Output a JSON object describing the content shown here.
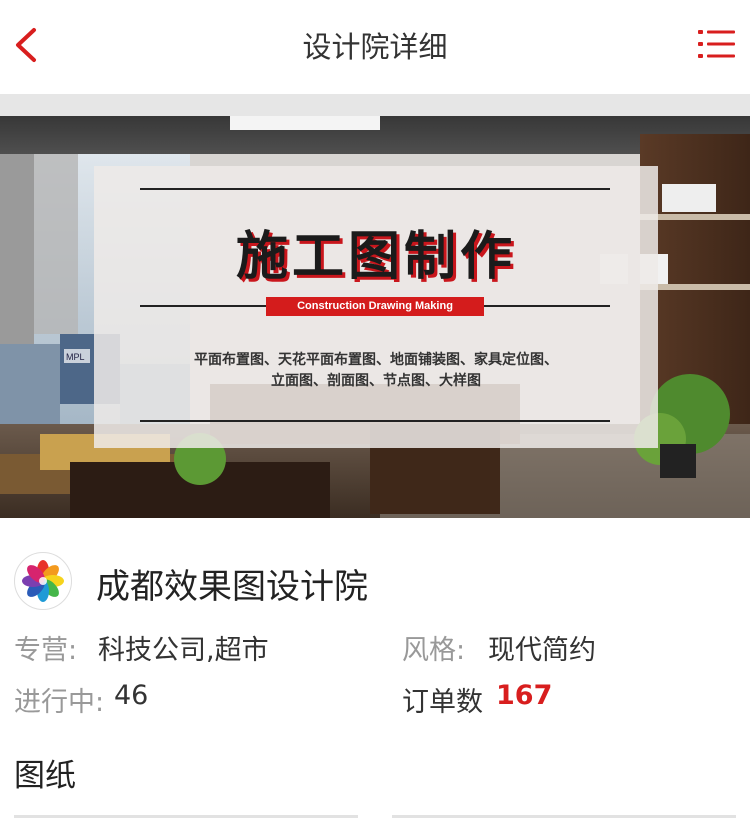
{
  "header": {
    "title": "设计院详细",
    "back_icon": "chevron-left-icon",
    "menu_icon": "list-menu-icon",
    "accent": "#d81e1e"
  },
  "banner": {
    "heading": "施工图制作",
    "subheading": "Construction Drawing Making",
    "line1": "平面布置图、天花平面布置图、地面铺装图、家具定位图、",
    "line2": "立面图、剖面图、节点图、大样图",
    "sign_text": "MPL"
  },
  "firm": {
    "name": "成都效果图设计院",
    "specialty_label": "专营:",
    "specialty_value": "科技公司,超市",
    "style_label": "风格:",
    "style_value": "现代简约",
    "in_progress_label": "进行中:",
    "in_progress_value": "46",
    "orders_label": "订单数",
    "orders_value": "167"
  },
  "drawings": {
    "title": "图纸"
  }
}
